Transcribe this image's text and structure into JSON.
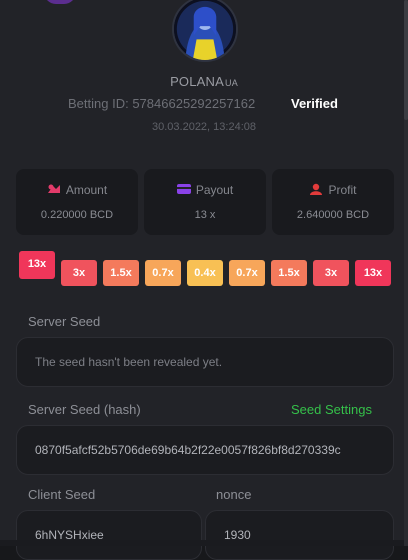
{
  "user": {
    "name": "POLANA",
    "flag": "UA",
    "betting_id_label": "Betting ID:",
    "betting_id": "57846625292257162",
    "verified": "Verified",
    "datetime": "30.03.2022, 13:24:08"
  },
  "stats": [
    {
      "label": "Amount",
      "value": "0.220000 BCD",
      "icon": "coins-icon",
      "color": "#e23b6a"
    },
    {
      "label": "Payout",
      "value": "13 x",
      "icon": "card-icon",
      "color": "#8a42e8"
    },
    {
      "label": "Profit",
      "value": "2.640000 BCD",
      "icon": "profit-icon",
      "color": "#e23b3b"
    }
  ],
  "multipliers": [
    "13x",
    "3x",
    "1.5x",
    "0.7x",
    "0.4x",
    "0.7x",
    "1.5x",
    "3x",
    "13x"
  ],
  "multiplier_colors": [
    "#f0365a",
    "#f0535d",
    "#f47a5c",
    "#f7a65a",
    "#f8c054",
    "#f7a65a",
    "#f47a5c",
    "#f0535d",
    "#f0365a"
  ],
  "active_index": 0,
  "server_seed": {
    "label": "Server Seed",
    "value": "The seed hasn't been revealed yet."
  },
  "server_seed_hash": {
    "label": "Server Seed (hash)",
    "settings_link": "Seed Settings",
    "value": "0870f5afcf52b5706de69b64b2f22e0057f826bf8d270339c"
  },
  "client_seed": {
    "label": "Client Seed",
    "value": "6hNYSHxiee"
  },
  "nonce": {
    "label": "nonce",
    "value": "1930"
  }
}
